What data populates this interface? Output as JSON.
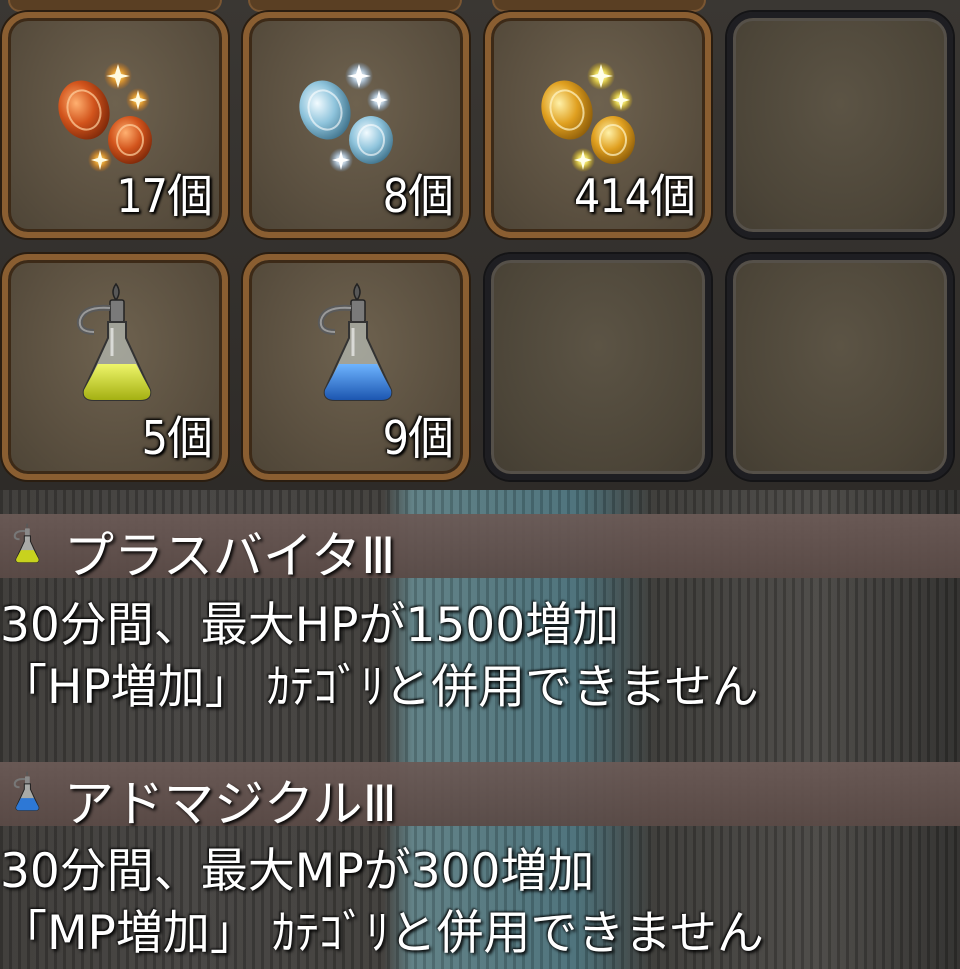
{
  "inventory": {
    "slots": [
      {
        "icon": "bronze-medals-icon",
        "count": "17個",
        "accent": "#c2521c"
      },
      {
        "icon": "silver-medals-icon",
        "count": "8個",
        "accent": "#9fd0e8"
      },
      {
        "icon": "gold-medals-icon",
        "count": "414個",
        "accent": "#e0a020"
      },
      {
        "icon": "empty-slot",
        "count": ""
      },
      {
        "icon": "yellow-potion-icon",
        "count": "5個",
        "accent": "#c8d21e"
      },
      {
        "icon": "blue-potion-icon",
        "count": "9個",
        "accent": "#2d78d6"
      },
      {
        "icon": "empty-slot",
        "count": ""
      },
      {
        "icon": "empty-slot",
        "count": ""
      }
    ]
  },
  "items": [
    {
      "name": "プラスバイタⅢ",
      "line1": "30分間、最大HPが1500増加",
      "line2": "「HP増加」 ｶﾃｺﾞﾘと併用できません",
      "icon": "yellow-potion-icon"
    },
    {
      "name": "アドマジクルⅢ",
      "line1": "30分間、最大MPが300増加",
      "line2": "「MP増加」 ｶﾃｺﾞﾘと併用できません",
      "icon": "blue-potion-icon"
    }
  ]
}
